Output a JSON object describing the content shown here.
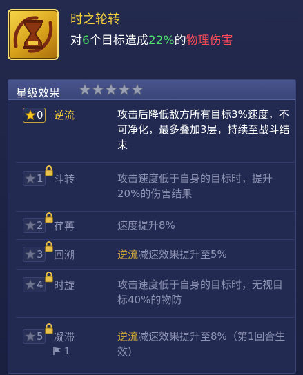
{
  "skill": {
    "icon": "hourglass-icon",
    "name": "时之轮转",
    "desc_prefix": "对",
    "target_count": "6",
    "desc_mid": "个目标造成",
    "damage_pct": "22%",
    "desc_of": "的",
    "damage_type": "物理伤害"
  },
  "panel": {
    "title": "星级效果",
    "star_rating": 5,
    "rows": [
      {
        "level": "0",
        "name": "逆流",
        "locked": false,
        "desc": "攻击后降低敌方所有目标3%速度，不可净化，最多叠加3层，持续至战斗结束"
      },
      {
        "level": "1",
        "name": "斗转",
        "locked": true,
        "desc": "攻击速度低于自身的目标时，提升20%的伤害结果"
      },
      {
        "level": "2",
        "name": "荏苒",
        "locked": true,
        "desc": "速度提升8%"
      },
      {
        "level": "3",
        "name": "回溯",
        "locked": true,
        "ref": "逆流",
        "desc_rest": "减速效果提升至5%"
      },
      {
        "level": "4",
        "name": "时旋",
        "locked": true,
        "desc": "攻击速度低于自身的目标时，无视目标40%的物防"
      },
      {
        "level": "5",
        "name": "凝滞",
        "locked": true,
        "ref": "逆流",
        "desc_rest": "减速效果提升至8%（第1回合生效)",
        "flag_count": "1"
      }
    ]
  },
  "colors": {
    "gold": "#f2cf3a",
    "green": "#4fe26a",
    "red": "#ff4b55",
    "locked_text": "#8d93b2"
  }
}
